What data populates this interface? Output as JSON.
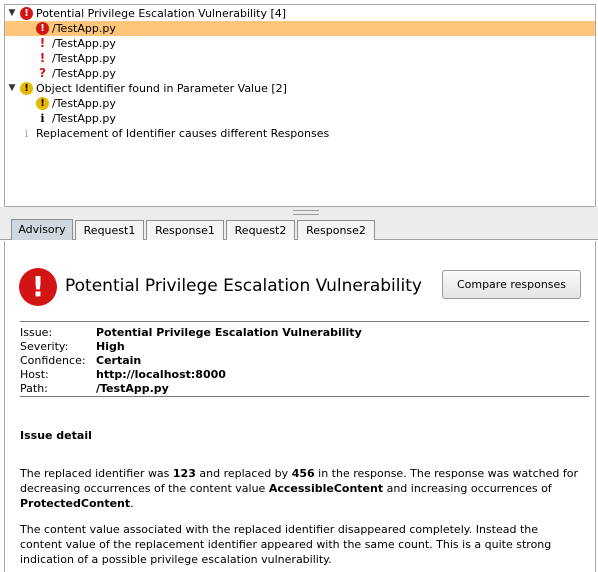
{
  "tree": {
    "groups": [
      {
        "label": "Potential Privilege Escalation Vulnerability [4]",
        "icon": "red-exclamation-circle-icon",
        "items": [
          {
            "label": "/TestApp.py",
            "icon": "red-exclamation-circle-icon",
            "selected": true
          },
          {
            "label": "/TestApp.py",
            "icon": "red-exclamation-icon",
            "selected": false
          },
          {
            "label": "/TestApp.py",
            "icon": "red-exclamation-icon",
            "selected": false
          },
          {
            "label": "/TestApp.py",
            "icon": "red-question-icon",
            "selected": false
          }
        ]
      },
      {
        "label": "Object Identifier found in Parameter Value [2]",
        "icon": "yellow-exclamation-circle-icon",
        "items": [
          {
            "label": "/TestApp.py",
            "icon": "yellow-exclamation-circle-icon",
            "selected": false
          },
          {
            "label": "/TestApp.py",
            "icon": "info-icon",
            "selected": false
          }
        ]
      }
    ],
    "extra_item": {
      "label": "Replacement of Identifier causes different Responses",
      "icon": "info-grey-icon"
    }
  },
  "tabs": [
    {
      "label": "Advisory",
      "active": true
    },
    {
      "label": "Request1",
      "active": false
    },
    {
      "label": "Response1",
      "active": false
    },
    {
      "label": "Request2",
      "active": false
    },
    {
      "label": "Response2",
      "active": false
    }
  ],
  "advisory": {
    "title": "Potential Privilege Escalation Vulnerability",
    "compare_button": "Compare responses",
    "meta": [
      {
        "key": "Issue:",
        "value": "Potential Privilege Escalation Vulnerability"
      },
      {
        "key": "Severity:",
        "value": "High"
      },
      {
        "key": "Confidence:",
        "value": "Certain"
      },
      {
        "key": "Host:",
        "value": "http://localhost:8000"
      },
      {
        "key": "Path:",
        "value": "/TestApp.py"
      }
    ],
    "detail_heading": "Issue detail",
    "para1": {
      "t1": "The replaced identifier was ",
      "b1": "123",
      "t2": " and replaced by ",
      "b2": "456",
      "t3": " in the response. The response was watched for decreasing occurrences of the content value ",
      "b3": "AccessibleContent",
      "t4": " and increasing occurrences of ",
      "b4": "ProtectedContent",
      "t5": "."
    },
    "para2": "The content value associated with the replaced identifier disappeared completely. Instead the content value of the replacement identifier appeared with the same count. This is a quite strong indication of a possible privilege escalation vulnerability."
  },
  "colors": {
    "selected_row": "#ffc67a",
    "high_severity": "#d21414",
    "medium_severity": "#e6b800",
    "active_tab": "#cfd8e0"
  }
}
